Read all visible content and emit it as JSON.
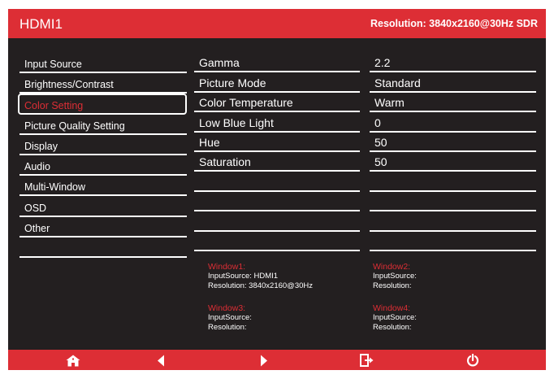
{
  "header": {
    "title": "HDMI1",
    "resolution": "Resolution: 3840x2160@30Hz SDR"
  },
  "menu": {
    "items": [
      "Input Source",
      "Brightness/Contrast",
      "Color Setting",
      "Picture Quality Setting",
      "Display",
      "Audio",
      "Multi-Window",
      "OSD",
      "Other",
      ""
    ],
    "selected_index": 2
  },
  "settings": {
    "labels": [
      "Gamma",
      "Picture Mode",
      "Color Temperature",
      "Low Blue Light",
      "Hue",
      "Saturation",
      "",
      "",
      "",
      ""
    ],
    "values": [
      "2.2",
      "Standard",
      "Warm",
      "0",
      "50",
      "50",
      "",
      "",
      "",
      ""
    ]
  },
  "windows": [
    {
      "title": "Window1:",
      "input": "InputSource: HDMI1",
      "resolution": "Resolution: 3840x2160@30Hz"
    },
    {
      "title": "Window2:",
      "input": "InputSource:",
      "resolution": "Resolution:"
    },
    {
      "title": "Window3:",
      "input": "InputSource:",
      "resolution": "Resolution:"
    },
    {
      "title": "Window4:",
      "input": "InputSource:",
      "resolution": "Resolution:"
    }
  ],
  "footer": {
    "icons": [
      "home-icon",
      "arrow-left-icon",
      "arrow-right-icon",
      "exit-icon",
      "power-icon"
    ]
  },
  "colors": {
    "accent": "#dd2e35",
    "background": "#231f20",
    "text": "#ffffff"
  }
}
